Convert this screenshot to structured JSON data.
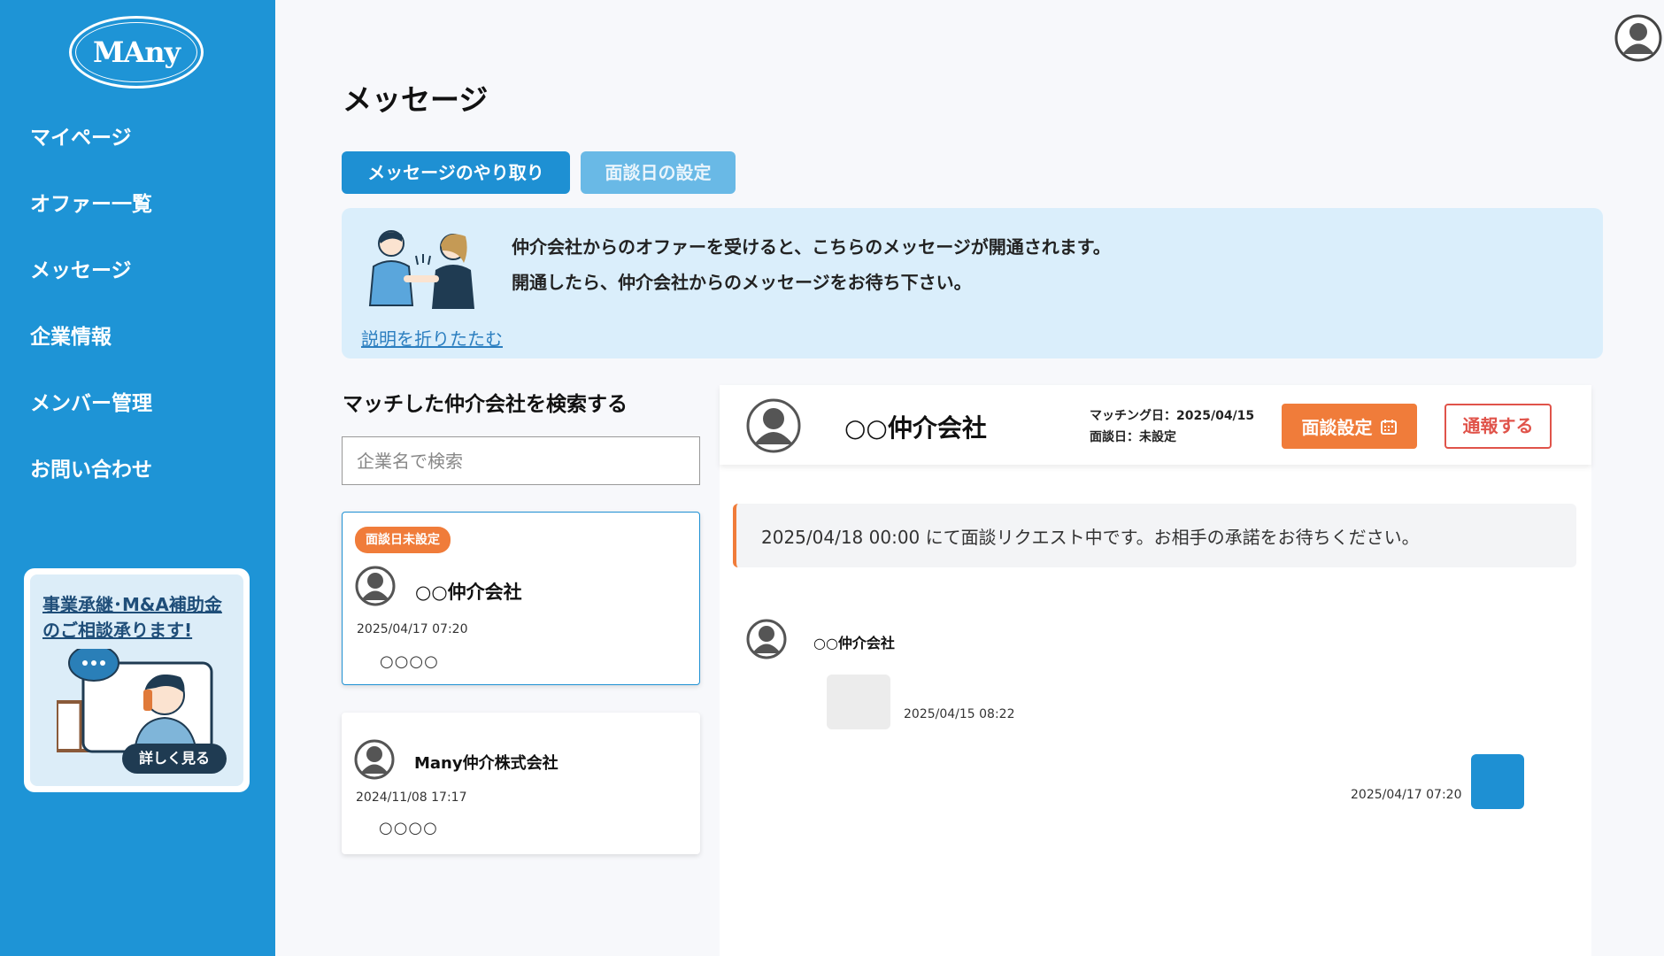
{
  "brand": {
    "logo_text": "MAny",
    "primary_color": "#1e94d6",
    "accent_color": "#f07c3a",
    "danger_color": "#e0534a"
  },
  "sidebar": {
    "items": [
      {
        "label": "マイページ"
      },
      {
        "label": "オファー一覧"
      },
      {
        "label": "メッセージ"
      },
      {
        "label": "企業情報"
      },
      {
        "label": "メンバー管理"
      },
      {
        "label": "お問い合わせ"
      }
    ],
    "promo": {
      "title_line1": "事業承継･M&A補助金",
      "title_line2": "のご相談承ります!",
      "button_label": "詳しく見る"
    }
  },
  "header": {
    "user_icon": "user-avatar-icon"
  },
  "main": {
    "title": "メッセージ",
    "tabs": [
      {
        "label": "メッセージのやり取り"
      },
      {
        "label": "面談日の設定"
      }
    ],
    "info": {
      "line1": "仲介会社からのオファーを受けると、こちらのメッセージが開通されます。",
      "line2": "開通したら、仲介会社からのメッセージをお待ち下さい。",
      "toggle_label": "説明を折りたたむ"
    },
    "search": {
      "heading": "マッチした仲介会社を検索する",
      "placeholder": "企業名で検索"
    },
    "conversations": [
      {
        "badge": "面談日未設定",
        "name": "○○仲介会社",
        "date": "2025/04/17 07:20",
        "preview": "○○○○"
      },
      {
        "badge": "",
        "name": "Many仲介株式会社",
        "date": "2024/11/08 17:17",
        "preview": "○○○○"
      }
    ]
  },
  "chat": {
    "partner_name": "○○仲介会社",
    "matching_date": "マッチング日：2025/04/15",
    "meeting_date": "面談日：未設定",
    "schedule_button": "面談設定",
    "report_button": "通報する",
    "notice": "2025/04/18 00:00 にて面談リクエスト中です。お相手の承諾をお待ちください。",
    "messages": [
      {
        "sender": "○○仲介会社",
        "time": "2025/04/15 08:22",
        "side": "left"
      },
      {
        "sender": "",
        "time": "2025/04/17 07:20",
        "side": "right"
      }
    ]
  }
}
